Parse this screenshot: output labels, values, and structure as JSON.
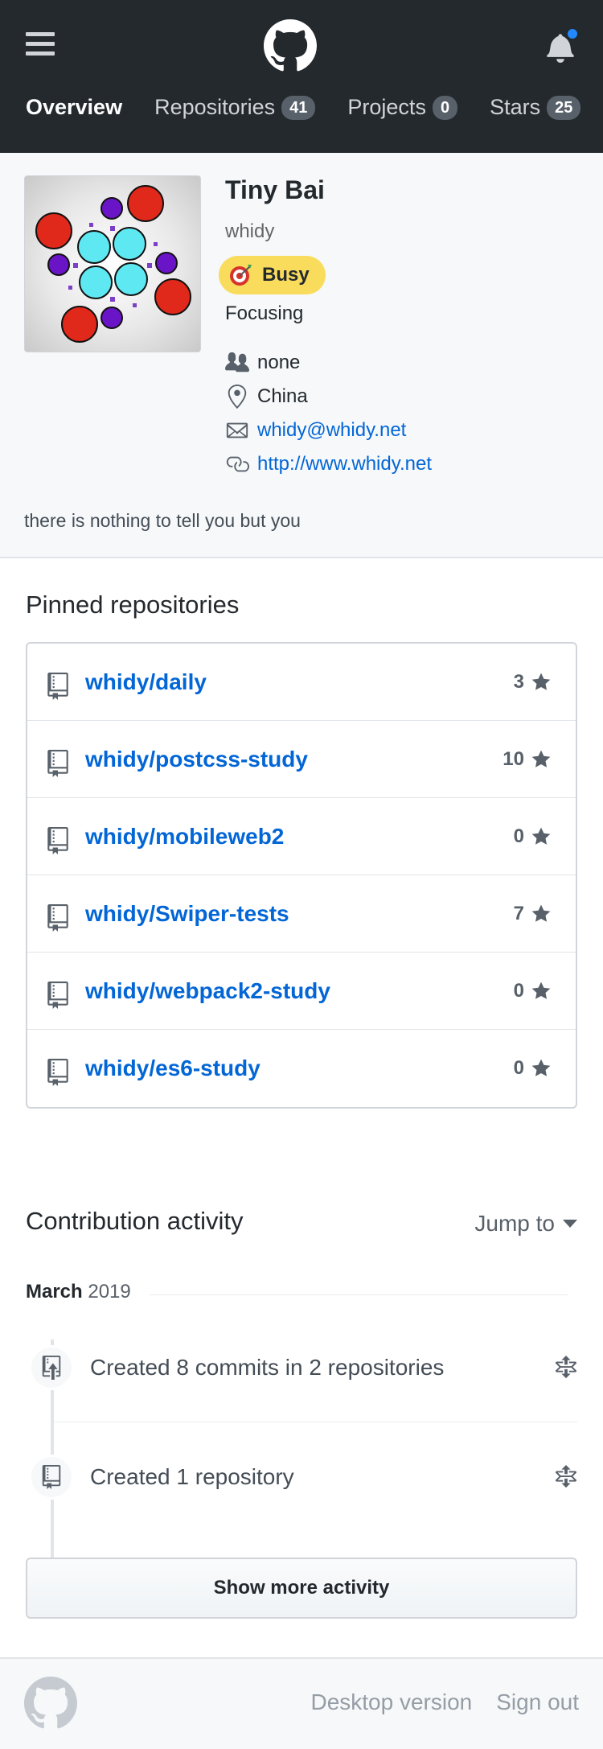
{
  "header": {
    "tabs": [
      {
        "label": "Overview",
        "count": null
      },
      {
        "label": "Repositories",
        "count": "41"
      },
      {
        "label": "Projects",
        "count": "0"
      },
      {
        "label": "Stars",
        "count": "25"
      }
    ]
  },
  "profile": {
    "full_name": "Tiny Bai",
    "username": "whidy",
    "status_label": "Busy",
    "status_message": "Focusing",
    "organization": "none",
    "location": "China",
    "email": "whidy@whidy.net",
    "website": "http://www.whidy.net",
    "bio": "there is nothing to tell you but you"
  },
  "pinned": {
    "title": "Pinned repositories",
    "repos": [
      {
        "name": "whidy/daily",
        "stars": "3"
      },
      {
        "name": "whidy/postcss-study",
        "stars": "10"
      },
      {
        "name": "whidy/mobileweb2",
        "stars": "0"
      },
      {
        "name": "whidy/Swiper-tests",
        "stars": "7"
      },
      {
        "name": "whidy/webpack2-study",
        "stars": "0"
      },
      {
        "name": "whidy/es6-study",
        "stars": "0"
      }
    ]
  },
  "contribution": {
    "title": "Contribution activity",
    "jump_label": "Jump to",
    "month": "March",
    "year": "2019",
    "activities": [
      {
        "text": "Created 8 commits in 2 repositories",
        "icon": "repo-push-icon"
      },
      {
        "text": "Created 1 repository",
        "icon": "repo-icon"
      }
    ],
    "show_more_label": "Show more activity"
  },
  "footer": {
    "desktop_label": "Desktop version",
    "signout_label": "Sign out"
  },
  "colors": {
    "header_bg": "#24292e",
    "link": "#0366d6",
    "busy": "#f9dc5c",
    "notification_dot": "#2188ff"
  }
}
